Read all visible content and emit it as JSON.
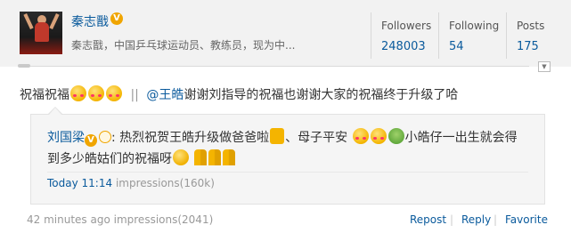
{
  "profile": {
    "name": "秦志戬",
    "bio": "秦志戬，中国乒乓球运动员、教练员，现为中..."
  },
  "stats": [
    {
      "label": "Followers",
      "value": "248003"
    },
    {
      "label": "Following",
      "value": "54"
    },
    {
      "label": "Posts",
      "value": "175"
    }
  ],
  "post": {
    "text_start": "祝福祝福",
    "separator": "||",
    "mention": "@王皓",
    "text_end": "谢谢刘指导的祝福也谢谢大家的祝福终于升级了哈"
  },
  "repost": {
    "author": "刘国梁",
    "text_1": ": 热烈祝贺王皓升级做爸爸啦",
    "text_2": "、母子平安",
    "text_3": "小皓仔一出生就会得到多少皓姑们的祝福呀",
    "time": "Today 11:14",
    "impressions": "impressions(160k)"
  },
  "footer": {
    "time": "42 minutes ago",
    "impressions": "impressions(2041)",
    "repost_label": "Repost",
    "reply_label": "Reply",
    "favorite_label": "Favorite"
  },
  "colors": {
    "link": "#0a5a9c",
    "header_bg": "#f2f2f2",
    "verified": "#f0a500"
  }
}
